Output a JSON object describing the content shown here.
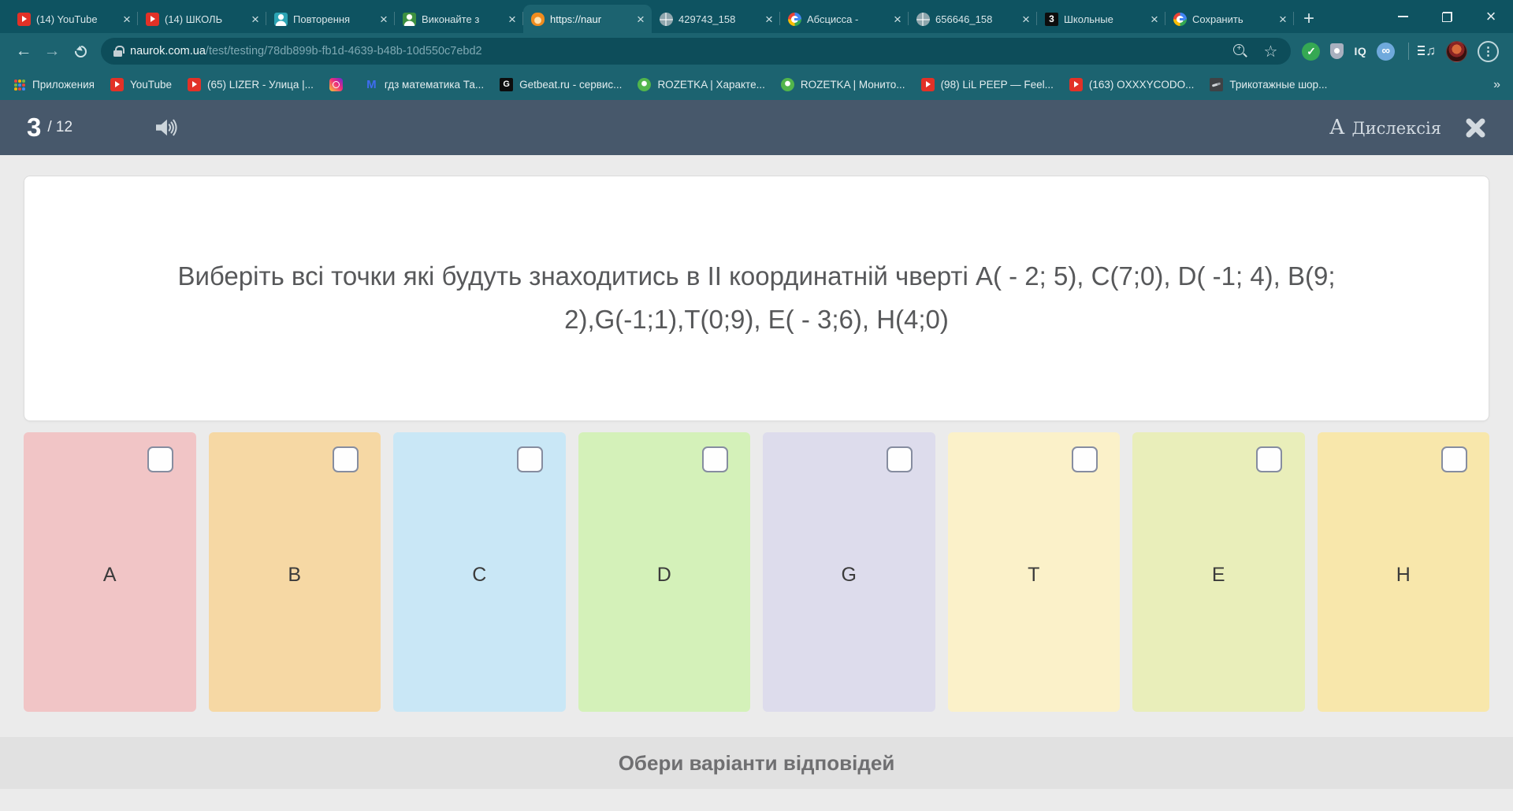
{
  "theme": {
    "chrome_dark_teal": "#0e5361",
    "chrome_toolbar_teal": "#1c6370",
    "quiz_header_slate": "#47586b",
    "page_background": "#ebebeb"
  },
  "browser": {
    "tabs": [
      {
        "title": "(14) YouTube",
        "icon": "youtube",
        "state": ""
      },
      {
        "title": "(14) ШКОЛЬ",
        "icon": "youtube",
        "state": ""
      },
      {
        "title": "Повторення",
        "icon": "person-teal",
        "state": ""
      },
      {
        "title": "Виконайте з",
        "icon": "person-green",
        "state": ""
      },
      {
        "title": "https://naur",
        "icon": "naurok",
        "state": "active"
      },
      {
        "title": "429743_158",
        "icon": "globe",
        "state": ""
      },
      {
        "title": "Абсцисса -",
        "icon": "google",
        "state": ""
      },
      {
        "title": "656646_158",
        "icon": "globe",
        "state": ""
      },
      {
        "title": "Школьные",
        "icon": "three",
        "state": ""
      },
      {
        "title": "Сохранить",
        "icon": "google",
        "state": ""
      }
    ],
    "url": {
      "domain": "naurok.com.ua",
      "path": "/test/testing/78db899b-fb1d-4639-b48b-10d550c7ebd2"
    },
    "toolbar": {
      "iq_label": "IQ",
      "infinity_label": "∞",
      "playlist_note": "♫"
    },
    "bookmarks": [
      {
        "label": "Приложения",
        "icon": "apps-grid"
      },
      {
        "label": "YouTube",
        "icon": "youtube"
      },
      {
        "label": "(65) LIZER - Улица |...",
        "icon": "youtube"
      },
      {
        "label": "",
        "icon": "instagram"
      },
      {
        "label": "гдз математика Та...",
        "icon": "gmail"
      },
      {
        "label": "Getbeat.ru - сервис...",
        "icon": "getbeat"
      },
      {
        "label": "ROZETKA | Характе...",
        "icon": "rozetka"
      },
      {
        "label": "ROZETKA | Монито...",
        "icon": "rozetka"
      },
      {
        "label": "(98) LiL PEEP — Feel...",
        "icon": "youtube"
      },
      {
        "label": "(163) OXXXYCODO...",
        "icon": "youtube"
      },
      {
        "label": "Трикотажные шор...",
        "icon": "knit"
      }
    ],
    "bookmarks_overflow": "»"
  },
  "quiz": {
    "progress": {
      "current": "3",
      "rest": "/ 12"
    },
    "dyslexia": {
      "prefix": "А",
      "label": "Дислексія"
    },
    "question": "Виберіть всі точки які будуть знаходитись в ІІ координатній чверті A( - 2; 5), C(7;0), D( -1; 4), B(9; 2),G(-1;1),T(0;9), E( - 3;6), H(4;0)",
    "answers": [
      {
        "letter": "A",
        "color": "#f1c5c6"
      },
      {
        "letter": "B",
        "color": "#f6d8a4"
      },
      {
        "letter": "C",
        "color": "#c9e7f6"
      },
      {
        "letter": "D",
        "color": "#d4f1b9"
      },
      {
        "letter": "G",
        "color": "#dddcec"
      },
      {
        "letter": "T",
        "color": "#fbf1c9"
      },
      {
        "letter": "E",
        "color": "#e9eeba"
      },
      {
        "letter": "H",
        "color": "#f8e7ab"
      }
    ],
    "footer": "Обери варіанти відповідей"
  }
}
